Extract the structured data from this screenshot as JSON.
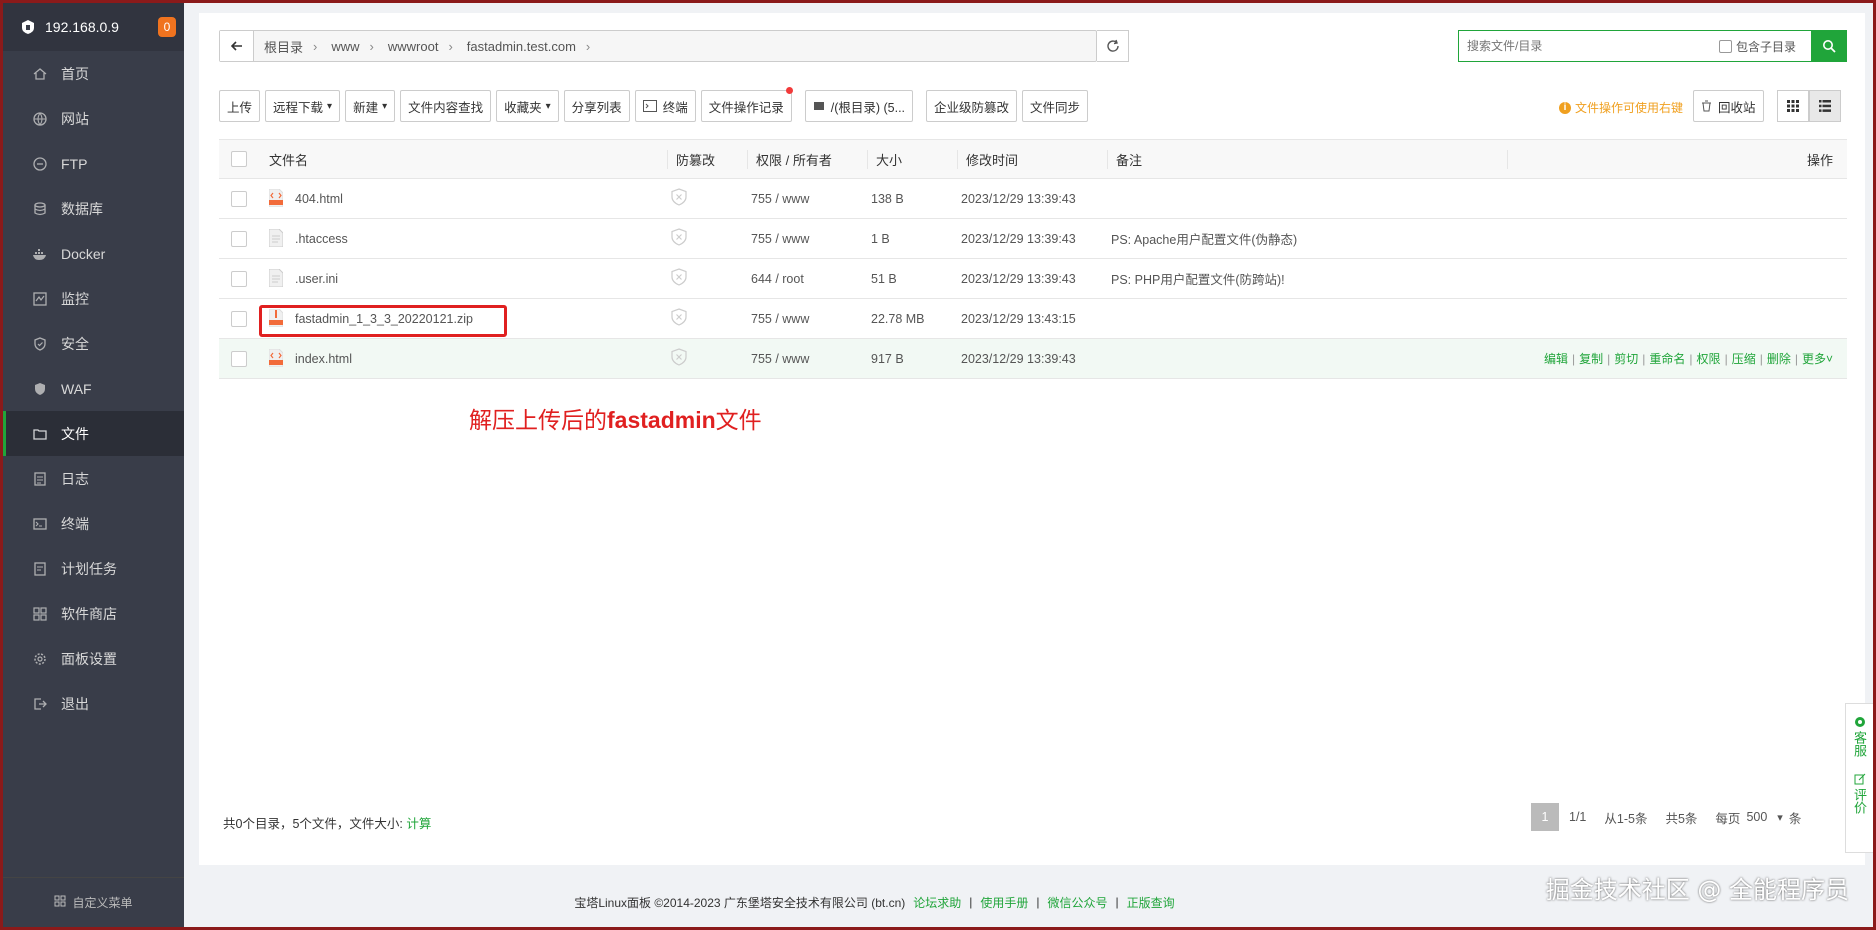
{
  "sidebar": {
    "ip": "192.168.0.9",
    "badge": "0",
    "items": [
      {
        "label": "首页",
        "icon": "home-icon"
      },
      {
        "label": "网站",
        "icon": "globe-icon"
      },
      {
        "label": "FTP",
        "icon": "ftp-icon"
      },
      {
        "label": "数据库",
        "icon": "database-icon"
      },
      {
        "label": "Docker",
        "icon": "docker-icon"
      },
      {
        "label": "监控",
        "icon": "monitor-icon"
      },
      {
        "label": "安全",
        "icon": "shield-icon"
      },
      {
        "label": "WAF",
        "icon": "waf-icon"
      },
      {
        "label": "文件",
        "icon": "folder-icon"
      },
      {
        "label": "日志",
        "icon": "log-icon"
      },
      {
        "label": "终端",
        "icon": "terminal-icon"
      },
      {
        "label": "计划任务",
        "icon": "clock-icon"
      },
      {
        "label": "软件商店",
        "icon": "apps-icon"
      },
      {
        "label": "面板设置",
        "icon": "gear-icon"
      },
      {
        "label": "退出",
        "icon": "logout-icon"
      }
    ],
    "active_index": 8,
    "footer_label": "自定义菜单"
  },
  "path": {
    "crumbs": [
      "根目录",
      "www",
      "wwwroot",
      "fastadmin.test.com"
    ]
  },
  "search": {
    "placeholder": "搜索文件/目录",
    "include_sub_label": "包含子目录"
  },
  "toolbar": {
    "upload": "上传",
    "remote_download": "远程下载",
    "new": "新建",
    "content_search": "文件内容查找",
    "favorites": "收藏夹",
    "share_list": "分享列表",
    "terminal": "终端",
    "op_log": "文件操作记录",
    "disk": "/(根目录) (5...",
    "tamper": "企业级防篡改",
    "sync": "文件同步",
    "tip": "文件操作可使用右键",
    "recycle": "回收站"
  },
  "table": {
    "headers": {
      "name": "文件名",
      "protect": "防篡改",
      "perm": "权限 / 所有者",
      "size": "大小",
      "mtime": "修改时间",
      "note": "备注",
      "ops": "操作"
    },
    "rows": [
      {
        "name": "404.html",
        "type": "html",
        "perm": "755 / www",
        "size": "138 B",
        "mtime": "2023/12/29 13:39:43",
        "note": ""
      },
      {
        "name": ".htaccess",
        "type": "text",
        "perm": "755 / www",
        "size": "1 B",
        "mtime": "2023/12/29 13:39:43",
        "note": "PS: Apache用户配置文件(伪静态)"
      },
      {
        "name": ".user.ini",
        "type": "text",
        "perm": "644 / root",
        "size": "51 B",
        "mtime": "2023/12/29 13:39:43",
        "note": "PS: PHP用户配置文件(防跨站)!"
      },
      {
        "name": "fastadmin_1_3_3_20220121.zip",
        "type": "zip",
        "perm": "755 / www",
        "size": "22.78 MB",
        "mtime": "2023/12/29 13:43:15",
        "note": ""
      },
      {
        "name": "index.html",
        "type": "html",
        "perm": "755 / www",
        "size": "917 B",
        "mtime": "2023/12/29 13:39:43",
        "note": ""
      }
    ],
    "row_ops": [
      "编辑",
      "复制",
      "剪切",
      "重命名",
      "权限",
      "压缩",
      "删除",
      "更多"
    ]
  },
  "annotation": {
    "prefix": "解压上传后的",
    "bold": "fastadmin",
    "suffix": "文件"
  },
  "summary": {
    "text": "共0个目录，5个文件，文件大小: ",
    "calc": "计算"
  },
  "pager": {
    "current": "1",
    "pages": "1/1",
    "range": "从1-5条",
    "total": "共5条",
    "per_page_label": "每页",
    "per_page": "500",
    "unit": "条"
  },
  "footer": {
    "copyright": "宝塔Linux面板 ©2014-2023 广东堡塔安全技术有限公司 (bt.cn)",
    "links": [
      "论坛求助",
      "使用手册",
      "微信公众号",
      "正版查询"
    ]
  },
  "watermark": "掘金技术社区 @ 全能程序员",
  "side_float": {
    "service": "客服",
    "rate": "评价"
  },
  "colors": {
    "brand_green": "#20a53a",
    "sidebar_bg": "#393d49",
    "annotation_red": "#e02020",
    "badge_orange": "#f0731f"
  }
}
